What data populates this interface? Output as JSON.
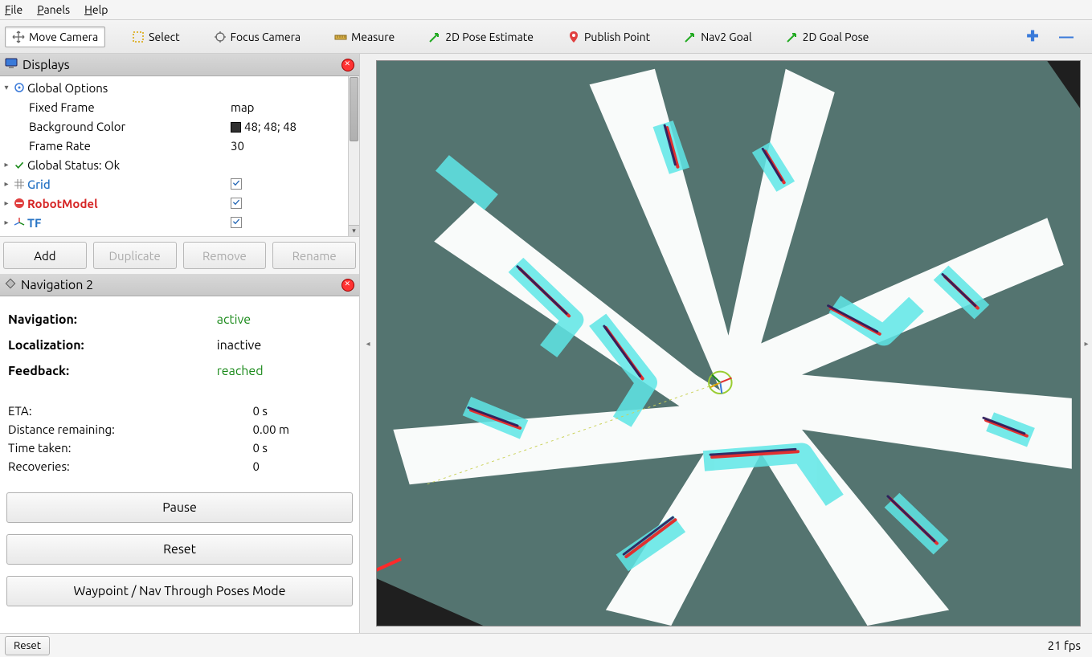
{
  "menubar": {
    "file": "File",
    "panels": "Panels",
    "help": "Help"
  },
  "toolbar": {
    "move_camera": "Move Camera",
    "select": "Select",
    "focus_camera": "Focus Camera",
    "measure": "Measure",
    "pose_estimate": "2D Pose Estimate",
    "publish_point": "Publish Point",
    "nav2_goal": "Nav2 Goal",
    "goal_pose": "2D Goal Pose"
  },
  "displays_panel": {
    "title": "Displays",
    "global_options": "Global Options",
    "fixed_frame_k": "Fixed Frame",
    "fixed_frame_v": "map",
    "bgcolor_k": "Background Color",
    "bgcolor_v": "48; 48; 48",
    "framerate_k": "Frame Rate",
    "framerate_v": "30",
    "global_status": "Global Status: Ok",
    "grid": "Grid",
    "robotmodel": "RobotModel",
    "tf": "TF",
    "btn_add": "Add",
    "btn_duplicate": "Duplicate",
    "btn_remove": "Remove",
    "btn_rename": "Rename"
  },
  "nav_panel": {
    "title": "Navigation 2",
    "navigation_k": "Navigation:",
    "navigation_v": "active",
    "localization_k": "Localization:",
    "localization_v": "inactive",
    "feedback_k": "Feedback:",
    "feedback_v": "reached",
    "eta_k": "ETA:",
    "eta_v": "0 s",
    "dist_k": "Distance remaining:",
    "dist_v": "0.00 m",
    "time_k": "Time taken:",
    "time_v": "0 s",
    "rec_k": "Recoveries:",
    "rec_v": "0",
    "btn_pause": "Pause",
    "btn_reset": "Reset",
    "btn_waypoint": "Waypoint / Nav Through Poses Mode"
  },
  "statusbar": {
    "reset": "Reset",
    "fps": "21 fps"
  },
  "colors": {
    "accent_green": "#1a8a1a",
    "accent_red": "#d62626",
    "accent_blue": "#2673c4"
  }
}
